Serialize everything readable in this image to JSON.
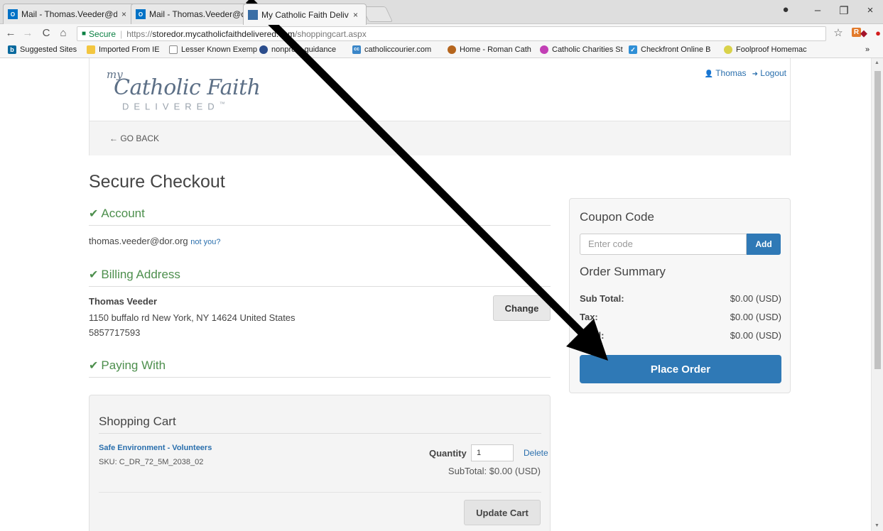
{
  "browser": {
    "tabs": [
      {
        "label": "Mail - Thomas.Veeder@d",
        "favicon": "outlook-icon"
      },
      {
        "label": "Mail - Thomas.Veeder@d",
        "favicon": "outlook-icon"
      },
      {
        "label": "My Catholic Faith Deliver",
        "favicon": "site-icon"
      }
    ],
    "favicon_text": "O",
    "close_glyph": "×",
    "window_controls": [
      "–",
      "❐",
      "×"
    ],
    "profile_glyph": "●",
    "nav": {
      "back": "←",
      "forward": "→",
      "reload": "C",
      "home": "⌂"
    },
    "address": {
      "secure_label": "Secure",
      "url_scheme": "https://",
      "url_host": "storedor.mycatholicfaithdelivered.com",
      "url_path": "/shoppingcart.aspx"
    },
    "toolbar_icons": {
      "star": "☆",
      "ext1": "R",
      "ext2": "◆",
      "ext3": "●"
    },
    "bookmarks": [
      {
        "label": "Suggested Sites",
        "icon": "bing-icon",
        "glyph": "b"
      },
      {
        "label": "Imported From IE",
        "icon": "folder-icon",
        "glyph": ""
      },
      {
        "label": "Lesser Known Exemp",
        "icon": "page-icon",
        "glyph": ""
      },
      {
        "label": "nonprofit-guidance",
        "icon": "globe-icon",
        "glyph": ""
      },
      {
        "label": "catholiccourier.com",
        "icon": "cc-icon",
        "glyph": "cc"
      },
      {
        "label": "Home - Roman Cath",
        "icon": "diocese-icon",
        "glyph": ""
      },
      {
        "label": "Catholic Charities St",
        "icon": "charities-icon",
        "glyph": ""
      },
      {
        "label": "Checkfront Online B",
        "icon": "checkfront-icon",
        "glyph": "✓"
      },
      {
        "label": "Foolproof Homemac",
        "icon": "recipe-icon",
        "glyph": ""
      }
    ],
    "bookmarks_more": "»"
  },
  "site": {
    "logo": {
      "my": "my",
      "main": "Catholic Faith",
      "sub": "DELIVERED",
      "tm": "™"
    },
    "user_name": "Thomas",
    "logout_label": "Logout",
    "user_glyph": "👤",
    "logout_glyph": "➜",
    "go_back": "← GO BACK"
  },
  "checkout": {
    "title": "Secure Checkout",
    "check_glyph": "✔",
    "account": {
      "heading": "Account",
      "email": "thomas.veeder@dor.org",
      "not_you": "not you?"
    },
    "billing": {
      "heading": "Billing Address",
      "name": "Thomas Veeder",
      "address": "1150 buffalo rd New York, NY 14624 United States",
      "phone": "5857717593",
      "change_label": "Change"
    },
    "paying": {
      "heading": "Paying With"
    },
    "cart": {
      "heading": "Shopping Cart",
      "item_name": "Safe Environment - Volunteers",
      "sku": "SKU: C_DR_72_5M_2038_02",
      "quantity_label": "Quantity",
      "quantity_value": "1",
      "delete_label": "Delete",
      "subtotal": "SubTotal: $0.00 (USD)",
      "update_label": "Update Cart"
    }
  },
  "summary": {
    "coupon_heading": "Coupon Code",
    "coupon_placeholder": "Enter code",
    "add_label": "Add",
    "order_heading": "Order Summary",
    "rows": [
      {
        "label": "Sub Total:",
        "value": "$0.00 (USD)"
      },
      {
        "label": "Tax:",
        "value": "$0.00 (USD)"
      },
      {
        "label": "Total:",
        "value": "$0.00 (USD)"
      }
    ],
    "place_order_label": "Place Order"
  },
  "annotation": {
    "arrow_color": "#000000"
  }
}
